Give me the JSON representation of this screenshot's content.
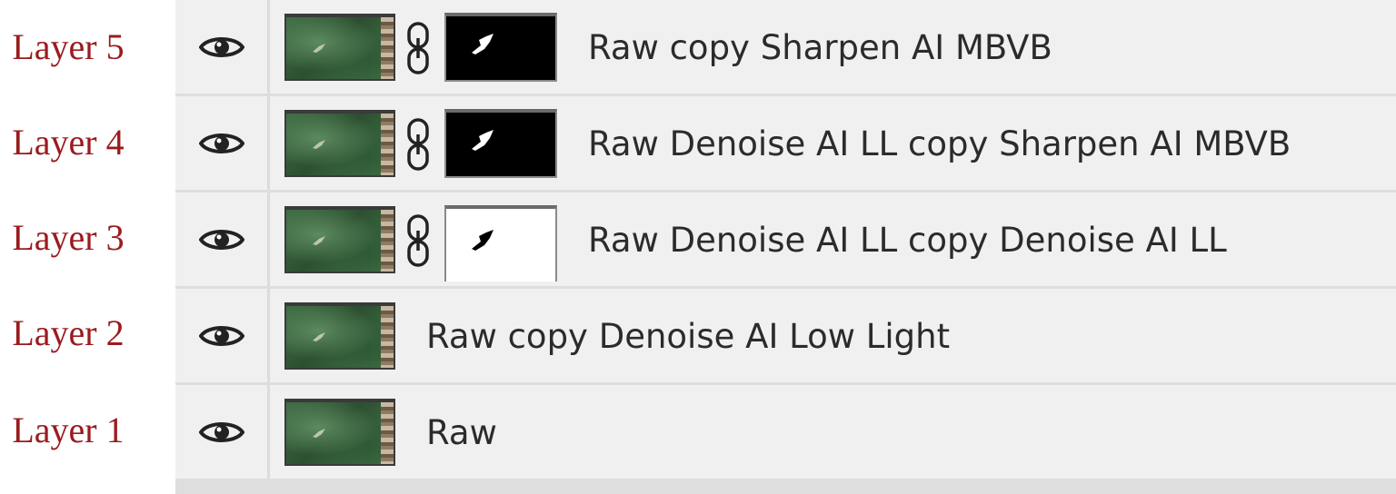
{
  "annotations": [
    "Layer 5",
    "Layer 4",
    "Layer 3",
    "Layer 2",
    "Layer 1"
  ],
  "colors": {
    "annotation_text": "#9b1b1e",
    "panel_bg": "#f0f0f0",
    "separator": "#dedede",
    "layer_text": "#2b2b2b"
  },
  "layers_panel": {
    "layers": [
      {
        "name": "Raw copy Sharpen AI MBVB",
        "visible": true,
        "has_mask": true,
        "mask_color": "black",
        "linked": true,
        "visibility_icon": "eye-icon",
        "link_icon": "chain-link-icon"
      },
      {
        "name": "Raw Denoise AI LL copy Sharpen AI MBVB",
        "visible": true,
        "has_mask": true,
        "mask_color": "black",
        "linked": true,
        "visibility_icon": "eye-icon",
        "link_icon": "chain-link-icon"
      },
      {
        "name": "Raw Denoise AI LL copy Denoise AI LL",
        "visible": true,
        "has_mask": true,
        "mask_color": "white",
        "linked": true,
        "visibility_icon": "eye-icon",
        "link_icon": "chain-link-icon"
      },
      {
        "name": "Raw copy Denoise AI Low Light",
        "visible": true,
        "has_mask": false,
        "visibility_icon": "eye-icon"
      },
      {
        "name": "Raw",
        "visible": true,
        "has_mask": false,
        "visibility_icon": "eye-icon"
      }
    ]
  }
}
